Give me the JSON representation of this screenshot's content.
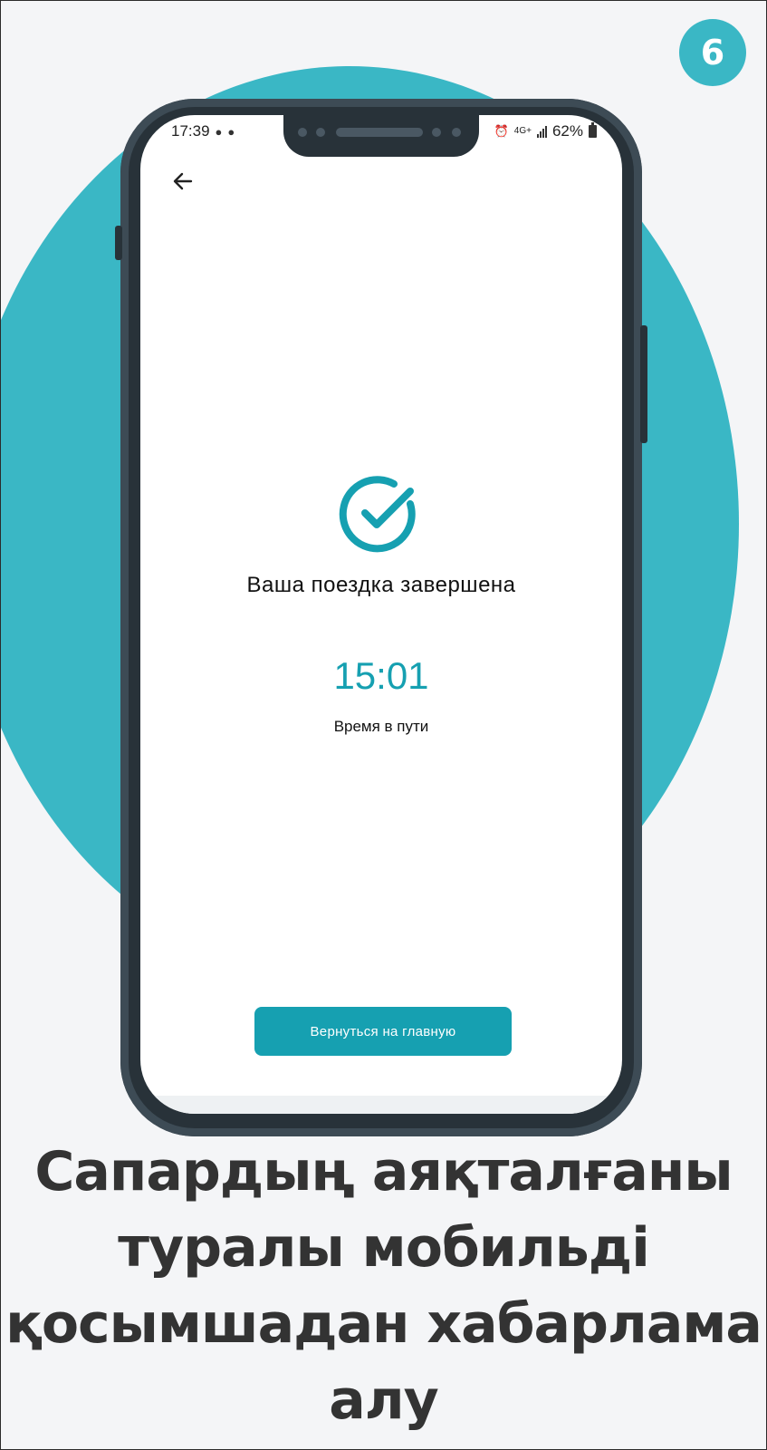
{
  "colors": {
    "accent": "#3ab7c5",
    "accent_dark": "#16a0b1"
  },
  "step": "6",
  "status_bar": {
    "time": "17:39",
    "network": "4G+",
    "battery": "62%"
  },
  "screen": {
    "back_icon": "arrow-left-icon",
    "success_icon": "check-circle-icon",
    "title": "Ваша поездка завершена",
    "duration_value": "15:01",
    "duration_label": "Время в пути",
    "home_button_label": "Вернуться на главную"
  },
  "caption": {
    "lines": [
      "Сапардың аяқталғаны",
      "туралы мобильді",
      "қосымшадан хабарлама",
      "алу"
    ]
  }
}
